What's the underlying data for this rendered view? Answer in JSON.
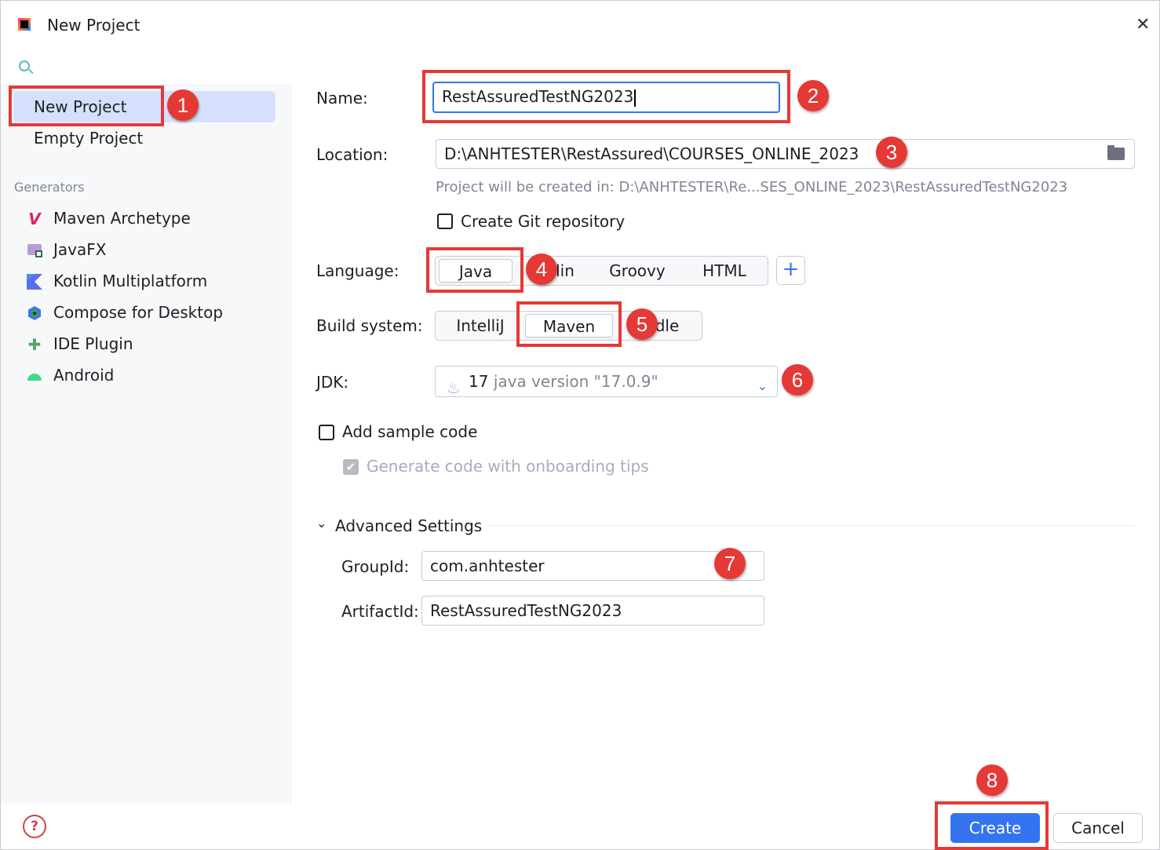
{
  "window": {
    "title": "New Project"
  },
  "sidebar": {
    "search_placeholder": "",
    "project_types": [
      {
        "label": "New Project",
        "selected": true
      },
      {
        "label": "Empty Project",
        "selected": false
      }
    ],
    "generators_label": "Generators",
    "generators": [
      {
        "label": "Maven Archetype",
        "icon": "maven-icon"
      },
      {
        "label": "JavaFX",
        "icon": "javafx-icon"
      },
      {
        "label": "Kotlin Multiplatform",
        "icon": "kotlin-icon"
      },
      {
        "label": "Compose for Desktop",
        "icon": "compose-icon"
      },
      {
        "label": "IDE Plugin",
        "icon": "plugin-icon"
      },
      {
        "label": "Android",
        "icon": "android-icon"
      }
    ]
  },
  "form": {
    "name_label": "Name:",
    "name_value": "RestAssuredTestNG2023",
    "location_label": "Location:",
    "location_value": "D:\\ANHTESTER\\RestAssured\\COURSES_ONLINE_2023",
    "location_hint": "Project will be created in: D:\\ANHTESTER\\Re...SES_ONLINE_2023\\RestAssuredTestNG2023",
    "git_label": "Create Git repository",
    "language_label": "Language:",
    "languages": [
      "Java",
      "lin",
      "Groovy",
      "HTML"
    ],
    "language_selected": "Java",
    "build_label": "Build system:",
    "build_systems": [
      "IntelliJ",
      "Maven",
      "dle"
    ],
    "build_selected": "Maven",
    "jdk_label": "JDK:",
    "jdk_version": "17",
    "jdk_detail": "java version \"17.0.9\"",
    "sample_label": "Add sample code",
    "onboarding_label": "Generate code with onboarding tips",
    "advanced_label": "Advanced Settings",
    "groupid_label": "GroupId:",
    "groupid_value": "com.anhtester",
    "artifactid_label": "ArtifactId:",
    "artifactid_value": "RestAssuredTestNG2023"
  },
  "annotations": [
    "1",
    "2",
    "3",
    "4",
    "5",
    "6",
    "7",
    "8"
  ],
  "footer": {
    "create_label": "Create",
    "cancel_label": "Cancel"
  },
  "colors": {
    "accent": "#3574f0",
    "annotation": "#e53935",
    "selection": "#d5e1fc"
  }
}
